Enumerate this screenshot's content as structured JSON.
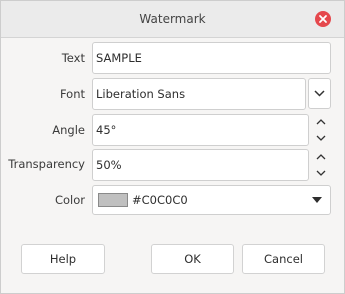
{
  "dialog": {
    "title": "Watermark"
  },
  "form": {
    "text": {
      "label": "Text",
      "value": "SAMPLE"
    },
    "font": {
      "label": "Font",
      "value": "Liberation Sans"
    },
    "angle": {
      "label": "Angle",
      "value": "45°"
    },
    "transparency": {
      "label": "Transparency",
      "value": "50%"
    },
    "color": {
      "label": "Color",
      "value": "#C0C0C0",
      "swatch": "#C0C0C0"
    }
  },
  "buttons": {
    "help": "Help",
    "ok": "OK",
    "cancel": "Cancel"
  },
  "icons": {
    "close": "close-icon",
    "font_dropdown": "chevron-down-icon",
    "spin_up": "chevron-up-icon",
    "spin_down": "chevron-down-icon",
    "color_dropdown": "caret-down-icon"
  },
  "colors": {
    "close_button": "#e5484d",
    "color_swatch": "#C0C0C0"
  }
}
